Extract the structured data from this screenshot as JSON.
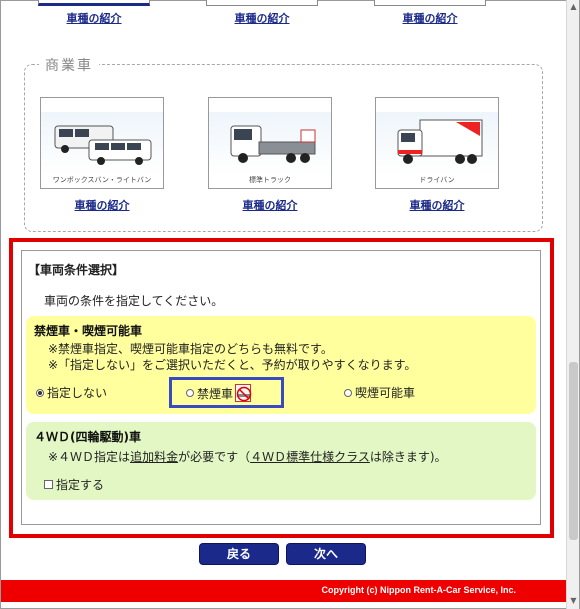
{
  "top_links": [
    "車種の紹介",
    "車種の紹介",
    "車種の紹介"
  ],
  "commercial": {
    "title": "商業車",
    "vehicles": [
      {
        "caption": "ワンボックスバン・ライトバン",
        "link": "車種の紹介"
      },
      {
        "caption": "標準トラック",
        "link": "車種の紹介"
      },
      {
        "caption": "ドライバン",
        "link": "車種の紹介"
      }
    ]
  },
  "conditions": {
    "title": "【車両条件選択】",
    "description": "車両の条件を指定してください。",
    "smoking": {
      "heading": "禁煙車・喫煙可能車",
      "note1": "※禁煙車指定、喫煙可能車指定のどちらも無料です。",
      "note2": "※「指定しない」をご選択いただくと、予約が取りやすくなります。",
      "options": [
        {
          "label": "指定しない",
          "selected": true
        },
        {
          "label": "禁煙車",
          "selected": false
        },
        {
          "label": "喫煙可能車",
          "selected": false
        }
      ]
    },
    "four_wd": {
      "heading": "４ＷＤ(四輪駆動)車",
      "note_prefix": "※４ＷＤ指定は",
      "note_link1": "追加料金",
      "note_mid": "が必要です（",
      "note_link2": "４ＷＤ標準仕様クラス",
      "note_suffix": "は除きます)。",
      "checkbox_label": "指定する",
      "checked": false
    }
  },
  "buttons": {
    "back": "戻る",
    "next": "次へ"
  },
  "footer": "Copyright (c) Nippon Rent-A-Car Service, Inc.",
  "colors": {
    "brand_red": "#ee0000",
    "nav_blue": "#1b2a8a",
    "smoke_bg": "#ffff9e",
    "wd_bg": "#e2f7c4",
    "highlight_blue": "#3a4bc0"
  }
}
